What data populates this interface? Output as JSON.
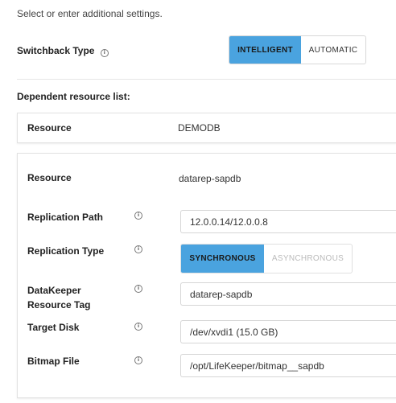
{
  "intro": "Select or enter additional settings.",
  "switchback": {
    "label": "Switchback Type",
    "info_icon": "info-circle-icon",
    "options": [
      "INTELLIGENT",
      "AUTOMATIC"
    ],
    "selected": "INTELLIGENT"
  },
  "dependent": {
    "title": "Dependent resource list:",
    "resource_label": "Resource",
    "resource_value": "DEMODB"
  },
  "details": {
    "resource_label": "Resource",
    "resource_value": "datarep-sapdb",
    "replication_path": {
      "label": "Replication Path",
      "value": "12.0.0.14/12.0.0.8"
    },
    "replication_type": {
      "label": "Replication Type",
      "options": [
        "SYNCHRONOUS",
        "ASYNCHRONOUS"
      ],
      "selected": "SYNCHRONOUS"
    },
    "resource_tag": {
      "label_line1": "DataKeeper",
      "label_line2": "Resource Tag",
      "value": "datarep-sapdb"
    },
    "target_disk": {
      "label": "Target Disk",
      "value": "/dev/xvdi1 (15.0 GB)"
    },
    "bitmap_file": {
      "label": "Bitmap File",
      "value": "/opt/LifeKeeper/bitmap__sapdb"
    }
  },
  "colors": {
    "accent": "#4aa3df",
    "border": "#d6d6d6"
  }
}
